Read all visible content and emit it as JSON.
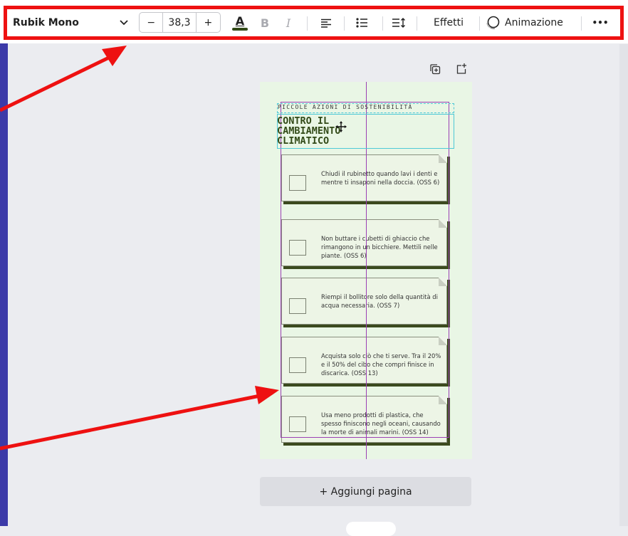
{
  "toolbar": {
    "font_family": "Rubik Mono",
    "font_size": "38,3",
    "decrease": "−",
    "increase": "+",
    "text_color_letter": "A",
    "bold": "B",
    "italic": "I",
    "effects": "Effetti",
    "animation": "Animazione",
    "more": "•••"
  },
  "page": {
    "subtitle": "PICCOLE AZIONI DI SOSTENIBILITÀ",
    "title": "CONTRO IL\nCAMBIAMENTO\nCLIMATICO",
    "items": [
      "Chiudi il rubinetto quando lavi i denti e mentre ti insaponi nella doccia. (OSS 6)",
      "Non buttare i cubetti di ghiaccio che rimangono in un bicchiere. Mettili nelle piante. (OSS 6)",
      "Riempi il bollitore solo della quantità di acqua necessaria. (OSS 7)",
      "Acquista solo ciò che ti serve. Tra il 20% e il 50% del cibo che compri finisce in discarica. (OSS 13)",
      "Usa meno prodotti di plastica, che spesso finiscono negli oceani, causando la morte di animali marini. (OSS 14)"
    ]
  },
  "add_page": "+ Aggiungi pagina",
  "icons": [
    "chevron-down-icon",
    "text-color-icon",
    "align-left-icon",
    "bulleted-list-icon",
    "line-spacing-icon",
    "animate-icon",
    "duplicate-page-icon",
    "add-page-icon",
    "move-cursor-icon"
  ],
  "colors": {
    "annotation": "#ee1111",
    "accent": "#3c3aa8",
    "page_bg": "#e9f6e5",
    "title_green": "#324a18",
    "guide": "#9b3fb4",
    "selection": "#4ec9d6"
  }
}
